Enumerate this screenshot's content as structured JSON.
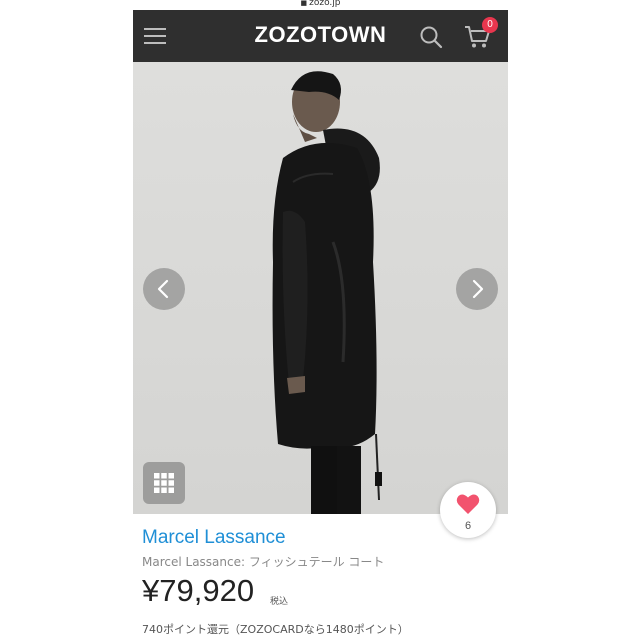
{
  "browser": {
    "url": "zozo.jp"
  },
  "header": {
    "logo": "ZOZOTOWN",
    "cart_count": "0",
    "icons": [
      "menu-icon",
      "search-icon",
      "cart-icon"
    ]
  },
  "gallery": {
    "icons": [
      "chevron-left-icon",
      "chevron-right-icon",
      "grid-icon"
    ]
  },
  "favorite": {
    "count": "6",
    "icon": "heart-icon",
    "color": "#f2536e"
  },
  "product": {
    "brand": "Marcel Lassance",
    "name": "Marcel Lassance: フィッシュテール コート",
    "price": "¥79,920",
    "tax_label": "税込",
    "points": "740ポイント還元（ZOZOCARDなら1480ポイント）"
  },
  "colors": {
    "header_bg": "#2f2f2f",
    "brand_link": "#1f8fd6",
    "badge": "#e8364e"
  }
}
